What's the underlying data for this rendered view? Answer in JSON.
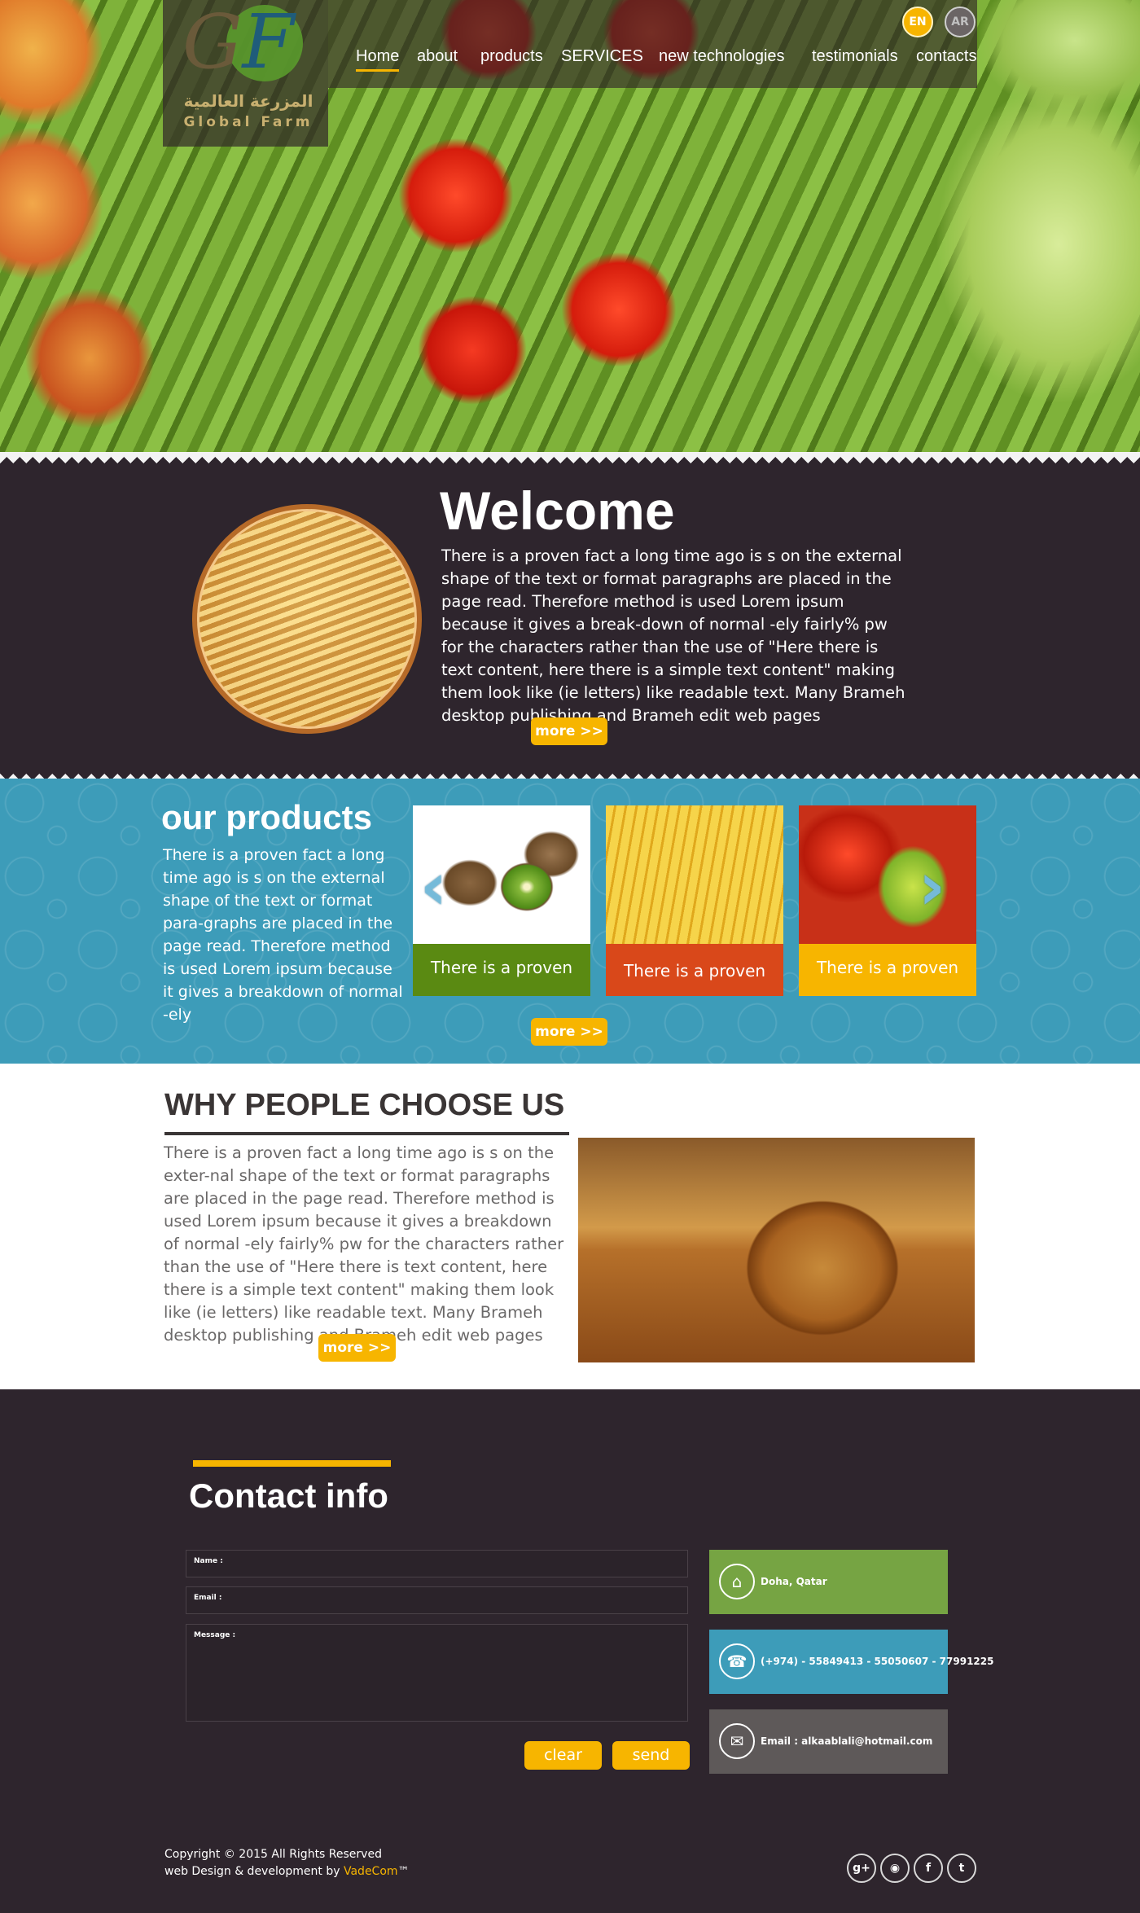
{
  "header": {
    "logo_arabic": "المزرعة العالمية",
    "logo_english": "Global Farm",
    "nav": [
      {
        "label": "Home",
        "active": true
      },
      {
        "label": "about"
      },
      {
        "label": "products"
      },
      {
        "label": "SERVICES"
      },
      {
        "label": "new technologies"
      },
      {
        "label": "testimonials"
      },
      {
        "label": "contacts"
      }
    ],
    "lang_en": "EN",
    "lang_ar": "AR"
  },
  "welcome": {
    "title": "Welcome",
    "text": "There is a proven fact a long time ago is s on the external shape of the text or format paragraphs are placed in the page read. Therefore method is used Lorem ipsum because it gives a break-down of normal -ely fairly% pw for the characters rather than the use of \"Here there is text content, here there is a simple text content\" making them look like (ie letters) like readable text. Many Brameh desktop publishing and Brameh edit web pages",
    "more_label": "more >>"
  },
  "products": {
    "title": "our products",
    "text": "There is a proven fact a long time ago is s on the external shape of the text or format para-graphs are placed in the page read. Therefore method is used Lorem ipsum because it gives a breakdown of normal -ely",
    "cards": [
      {
        "label": "There is a proven",
        "color": "#5a8a12"
      },
      {
        "label": "There is a proven",
        "color": "#d9481a"
      },
      {
        "label": "There is a proven",
        "color": "#f7b500"
      }
    ],
    "more_label": "more >>"
  },
  "why": {
    "title": "WHY PEOPLE CHOOSE US",
    "text": "There is a proven fact a long time ago is s on the exter-nal shape of the text or format paragraphs are placed in the page read. Therefore method is used Lorem ipsum because it gives a breakdown of normal -ely fairly% pw for the characters rather than the use of \"Here there is text content, here there is a simple text content\" making them look like (ie letters) like readable text. Many Brameh desktop publishing and Brameh edit web pages",
    "more_label": "more >>"
  },
  "contact": {
    "title": "Contact info",
    "name_label": "Name :",
    "email_label": "Email :",
    "message_label": "Message :",
    "clear_label": "clear",
    "send_label": "send",
    "address": "Doha, Qatar",
    "phone": "(+974) - 55849413 - 55050607 - 77991225",
    "email": "Email : alkaablali@hotmail.com"
  },
  "footer": {
    "copyright": "Copyright © 2015 All Rights Reserved",
    "credit_prefix": "web Design & development by ",
    "credit_brand": "VadeCom",
    "credit_suffix": "™",
    "social": [
      "google-plus-icon",
      "rss-icon",
      "facebook-icon",
      "twitter-icon"
    ]
  },
  "colors": {
    "accent": "#f7b500",
    "dark": "#2e252d",
    "teal": "#3d9cb9",
    "green": "#76a443"
  }
}
